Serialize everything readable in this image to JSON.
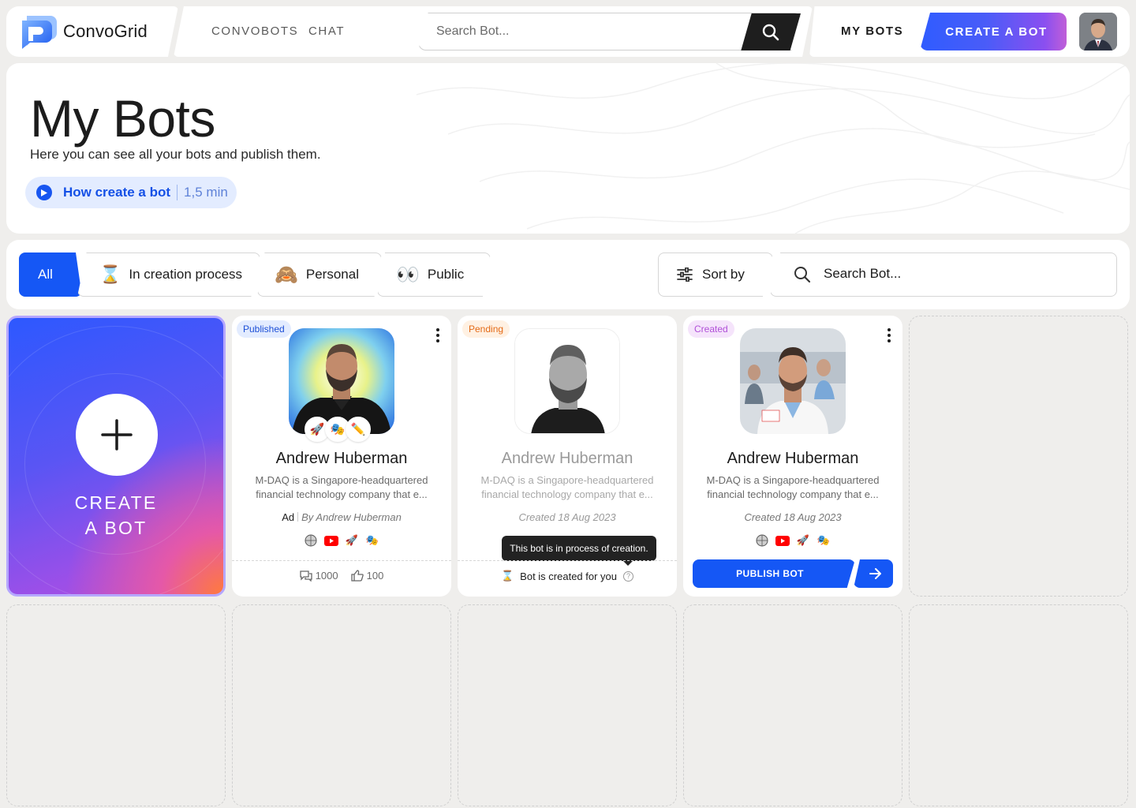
{
  "brand": {
    "name": "ConvoGrid",
    "accent": "#1557f5"
  },
  "nav": {
    "links": [
      "CONVOBOTS",
      "CHAT"
    ],
    "search_placeholder": "Search Bot...",
    "my_bots": "MY BOTS",
    "create_bot": "CREATE A BOT"
  },
  "hero": {
    "title": "My Bots",
    "subtitle": "Here you can see all your bots and publish them.",
    "howto_label": "How create a bot",
    "howto_time": "1,5 min"
  },
  "filters": {
    "tabs": [
      {
        "label": "All",
        "icon": "",
        "active": true
      },
      {
        "label": "In creation process",
        "icon": "⌛",
        "active": false
      },
      {
        "label": "Personal",
        "icon": "🙈",
        "active": false
      },
      {
        "label": "Public",
        "icon": "👀",
        "active": false
      }
    ],
    "sort_label": "Sort by",
    "search_placeholder": "Search Bot..."
  },
  "create_card": {
    "label": "CREATE\nA BOT"
  },
  "bots": [
    {
      "status": "Published",
      "name": "Andrew Huberman",
      "description": "M-DAQ is a Singapore-headquartered financial technology company that e...",
      "ad_label": "Ad",
      "byline": "By Andrew Huberman",
      "chips": [
        "🚀",
        "🎭",
        "✏️"
      ],
      "sources": [
        "globe-icon",
        "youtube-icon",
        "rocket-icon",
        "theater-icon"
      ],
      "messages": "1000",
      "likes": "100"
    },
    {
      "status": "Pending",
      "name": "Andrew Huberman",
      "description": "M-DAQ is a Singapore-headquartered financial technology company that e...",
      "meta": "Created 18 Aug 2023",
      "tooltip": "This bot is in process of creation.",
      "status_text": "Bot is created for you"
    },
    {
      "status": "Created",
      "name": "Andrew Huberman",
      "description": "M-DAQ is a Singapore-headquartered financial technology company that e...",
      "meta": "Created 18 Aug 2023",
      "sources": [
        "globe-icon",
        "youtube-icon",
        "rocket-icon",
        "theater-icon"
      ],
      "publish_label": "PUBLISH BOT"
    }
  ]
}
